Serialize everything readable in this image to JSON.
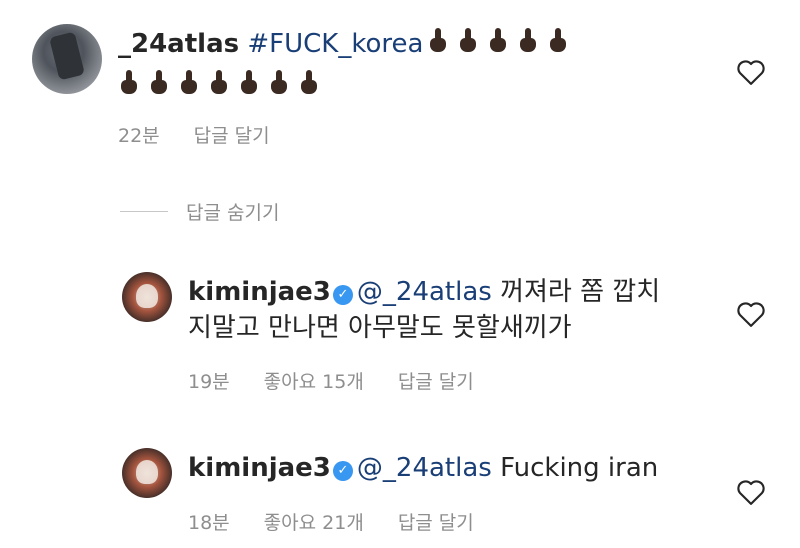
{
  "main_comment": {
    "username": "_24atlas",
    "hashtag": "#FUCK_korea",
    "emoji_icon": "middle-finger-icon",
    "emoji_color": "#3b2a22",
    "emoji_count_line1": 5,
    "emoji_count_line2": 7,
    "time": "22분",
    "reply_label": "답글 달기"
  },
  "replies_toggle": {
    "label": "답글 숨기기"
  },
  "replies": [
    {
      "username": "kiminjae3",
      "verified": true,
      "mention": "@_24atlas",
      "text_line1": "꺼져라 쫌 깝치",
      "text_line2": "지말고 만나면 아무말도 못할새끼가",
      "time": "19분",
      "likes": "좋아요 15개",
      "reply_label": "답글 달기"
    },
    {
      "username": "kiminjae3",
      "verified": true,
      "mention": "@_24atlas",
      "text_line1": "Fucking iran",
      "time": "18분",
      "likes": "좋아요 21개",
      "reply_label": "답글 달기"
    }
  ],
  "colors": {
    "link": "#1a3f77",
    "verified": "#3897f0",
    "meta": "#8e8e8e"
  }
}
